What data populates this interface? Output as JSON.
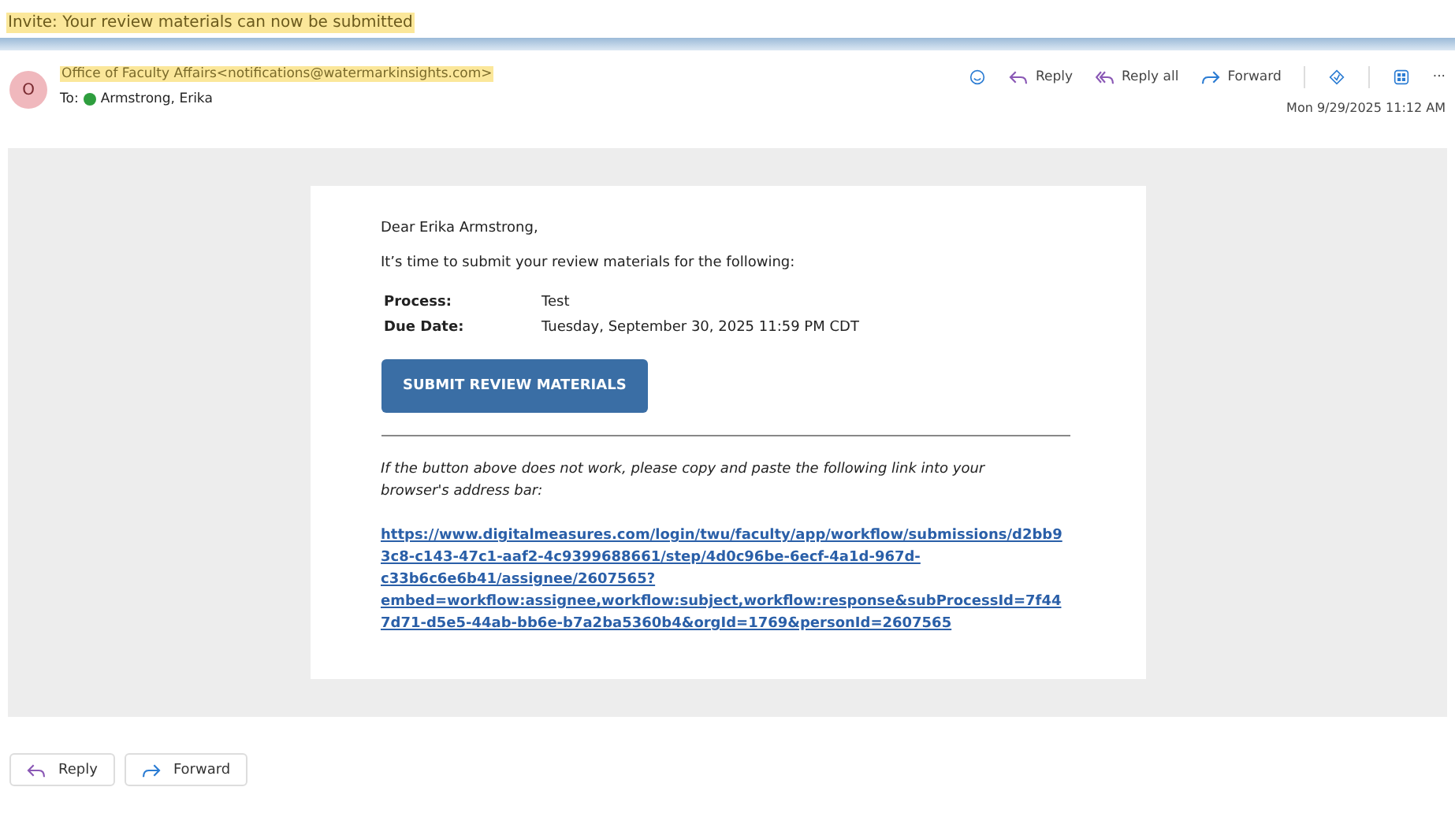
{
  "subject": "Invite: Your review materials can now be submitted",
  "sender": {
    "avatar": "O",
    "from": "Office of Faculty Affairs<notifications@watermarkinsights.com>",
    "to_label": "To:",
    "to": "Armstrong, Erika"
  },
  "toolbar": [
    {
      "kind": "emoji"
    },
    {
      "kind": "reply",
      "label": "Reply"
    },
    {
      "kind": "replyall",
      "label": "Reply all"
    },
    {
      "kind": "forward",
      "label": "Forward"
    },
    {
      "kind": "sep"
    },
    {
      "kind": "tag"
    },
    {
      "kind": "sep"
    },
    {
      "kind": "apps"
    },
    {
      "kind": "more",
      "label": "···"
    }
  ],
  "date": "Mon 9/29/2025 11:12 AM",
  "body": {
    "greeting": "Dear Erika Armstrong,",
    "intro": "It’s time to submit your review materials for the following:",
    "details": [
      {
        "label": "Process:",
        "value": "Test"
      },
      {
        "label": "Due Date:",
        "value": "Tuesday, September 30, 2025 11:59 PM CDT"
      }
    ],
    "button": "SUBMIT REVIEW MATERIALS",
    "fallback": "If the button above does not work, please copy and paste the following link into your browser's address bar:",
    "link": "https://www.digitalmeasures.com/login/twu/faculty/app/workflow/submissions/d2bb93c8-c143-47c1-aaf2-4c9399688661/step/4d0c96be-6ecf-4a1d-967d-c33b6c6e6b41/assignee/2607565?embed=workflow:assignee,workflow:subject,workflow:response&subProcessId=7f447d71-d5e5-44ab-bb6e-b7a2ba5360b4&orgId=1769&personId=2607565"
  },
  "footer_buttons": [
    {
      "kind": "reply",
      "label": "Reply"
    },
    {
      "kind": "forward",
      "label": "Forward"
    }
  ]
}
